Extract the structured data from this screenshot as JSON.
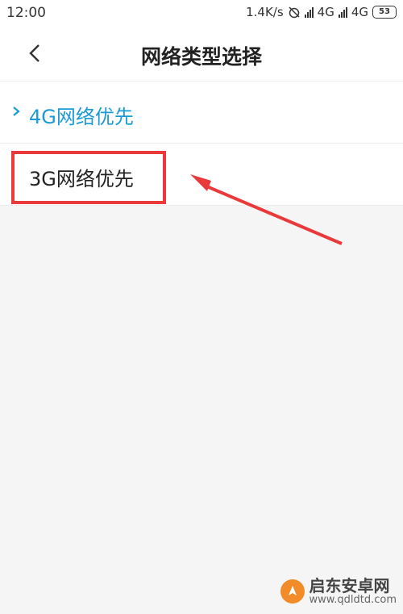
{
  "status_bar": {
    "time": "12:00",
    "speed": "1.4K/s",
    "network1": "4G",
    "network2": "4G",
    "battery": "53"
  },
  "header": {
    "title": "网络类型选择",
    "back_icon": "chevron-left-icon"
  },
  "options": [
    {
      "label": "4G网络优先",
      "selected": true
    },
    {
      "label": "3G网络优先",
      "selected": false
    }
  ],
  "annotation": {
    "color": "#e9393a"
  },
  "accent_color": "#1a9bd7",
  "watermark": {
    "title": "启东安卓网",
    "url": "www.qdldtd.com"
  }
}
